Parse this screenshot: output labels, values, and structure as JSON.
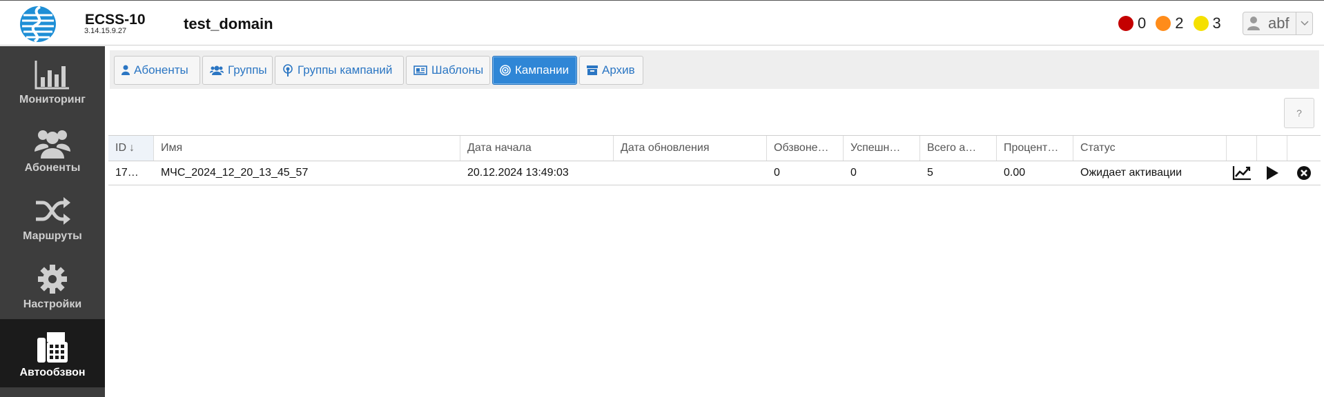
{
  "header": {
    "app_name": "ECSS-10",
    "version": "3.14.15.9.27",
    "domain": "test_domain",
    "alarms": [
      {
        "color": "#c40000",
        "count": "0"
      },
      {
        "color": "#ff8c1a",
        "count": "2"
      },
      {
        "color": "#f5e000",
        "count": "3"
      }
    ],
    "user": "abf"
  },
  "sidebar": {
    "items": [
      {
        "label": "Мониторинг",
        "icon": "bar-chart-icon"
      },
      {
        "label": "Абоненты",
        "icon": "users-icon"
      },
      {
        "label": "Маршруты",
        "icon": "shuffle-icon"
      },
      {
        "label": "Настройки",
        "icon": "gear-icon"
      },
      {
        "label": "Автообзвон",
        "icon": "fax-phone-icon",
        "active": true
      }
    ]
  },
  "tabs": [
    {
      "label": "Абоненты",
      "icon": "user-icon"
    },
    {
      "label": "Группы",
      "icon": "users-icon"
    },
    {
      "label": "Группы кампаний",
      "icon": "broadcast-icon"
    },
    {
      "label": "Шаблоны",
      "icon": "newspaper-icon"
    },
    {
      "label": "Кампании",
      "icon": "target-icon",
      "active": true
    },
    {
      "label": "Архив",
      "icon": "archive-icon"
    }
  ],
  "help_label": "?",
  "table": {
    "columns": [
      "ID",
      "Имя",
      "Дата начала",
      "Дата обновления",
      "Обзвоне…",
      "Успешн…",
      "Всего а…",
      "Процент…",
      "Статус"
    ],
    "sort_indicator": "↓",
    "rows": [
      {
        "id": "17…",
        "name": "МЧС_2024_12_20_13_45_57",
        "start": "20.12.2024 13:49:03",
        "updated": "",
        "called": "0",
        "success": "0",
        "total": "5",
        "percent": "0.00",
        "status": "Ожидает активации"
      }
    ]
  },
  "accent_color": "#2f86d6"
}
